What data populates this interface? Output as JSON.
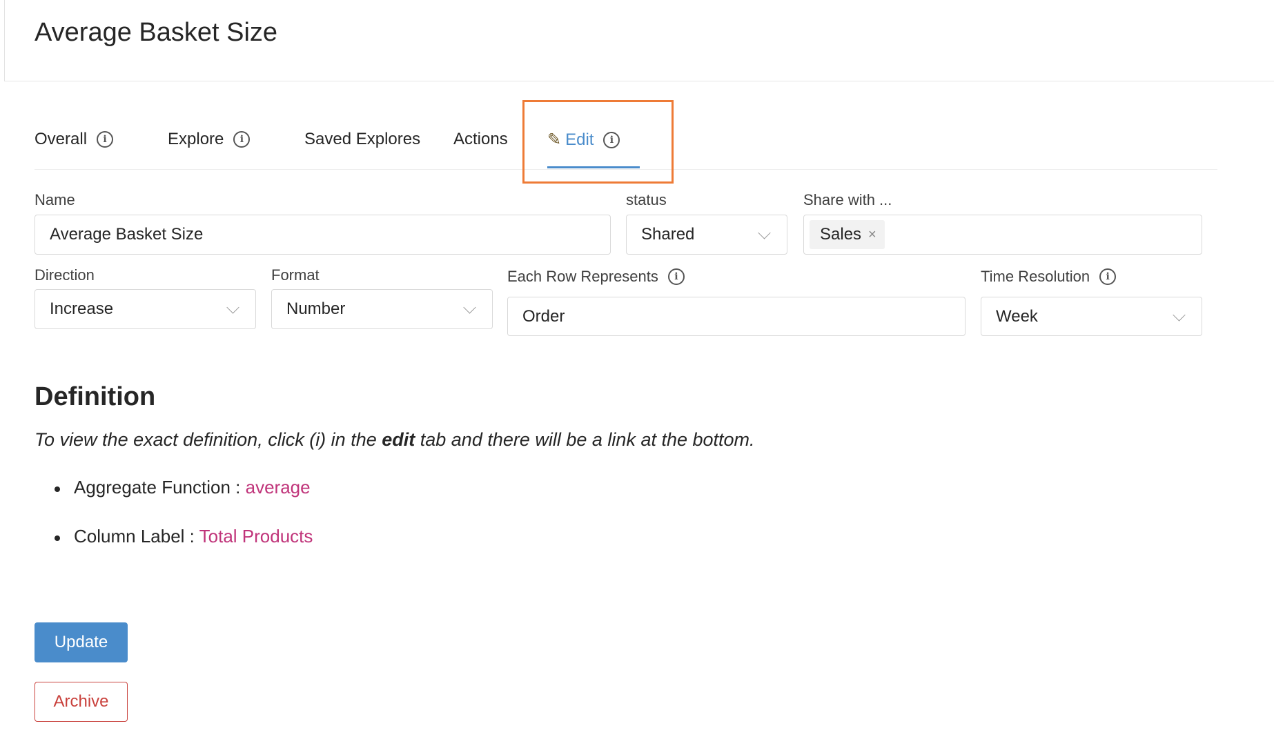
{
  "page": {
    "title": "Average Basket Size"
  },
  "tabs": [
    {
      "label": "Overall",
      "has_info": true,
      "active": false
    },
    {
      "label": "Explore",
      "has_info": true,
      "active": false
    },
    {
      "label": "Saved Explores",
      "has_info": false,
      "active": false
    },
    {
      "label": "Actions",
      "has_info": false,
      "active": false
    },
    {
      "label": "Edit",
      "has_info": true,
      "active": true,
      "icon": "pencil-icon"
    }
  ],
  "form": {
    "name": {
      "label": "Name",
      "value": "Average Basket Size"
    },
    "status": {
      "label": "status",
      "value": "Shared"
    },
    "share_with": {
      "label": "Share with ...",
      "tags": [
        "Sales"
      ]
    },
    "direction": {
      "label": "Direction",
      "value": "Increase"
    },
    "format": {
      "label": "Format",
      "value": "Number"
    },
    "each_row": {
      "label": "Each Row Represents",
      "value": "Order"
    },
    "time_resolution": {
      "label": "Time Resolution",
      "value": "Week"
    }
  },
  "definition": {
    "title": "Definition",
    "note_before": "To view the exact definition, click (i) in the ",
    "note_bold": "edit",
    "note_after": " tab and there will be a link at the bottom.",
    "items": [
      {
        "label": "Aggregate Function : ",
        "value": "average"
      },
      {
        "label": "Column Label : ",
        "value": "Total Products"
      }
    ]
  },
  "buttons": {
    "update": "Update",
    "archive": "Archive"
  },
  "colors": {
    "accent": "#4a8ccb",
    "highlight": "#ee7b36",
    "value_text": "#c0347a",
    "danger": "#c9413c"
  }
}
